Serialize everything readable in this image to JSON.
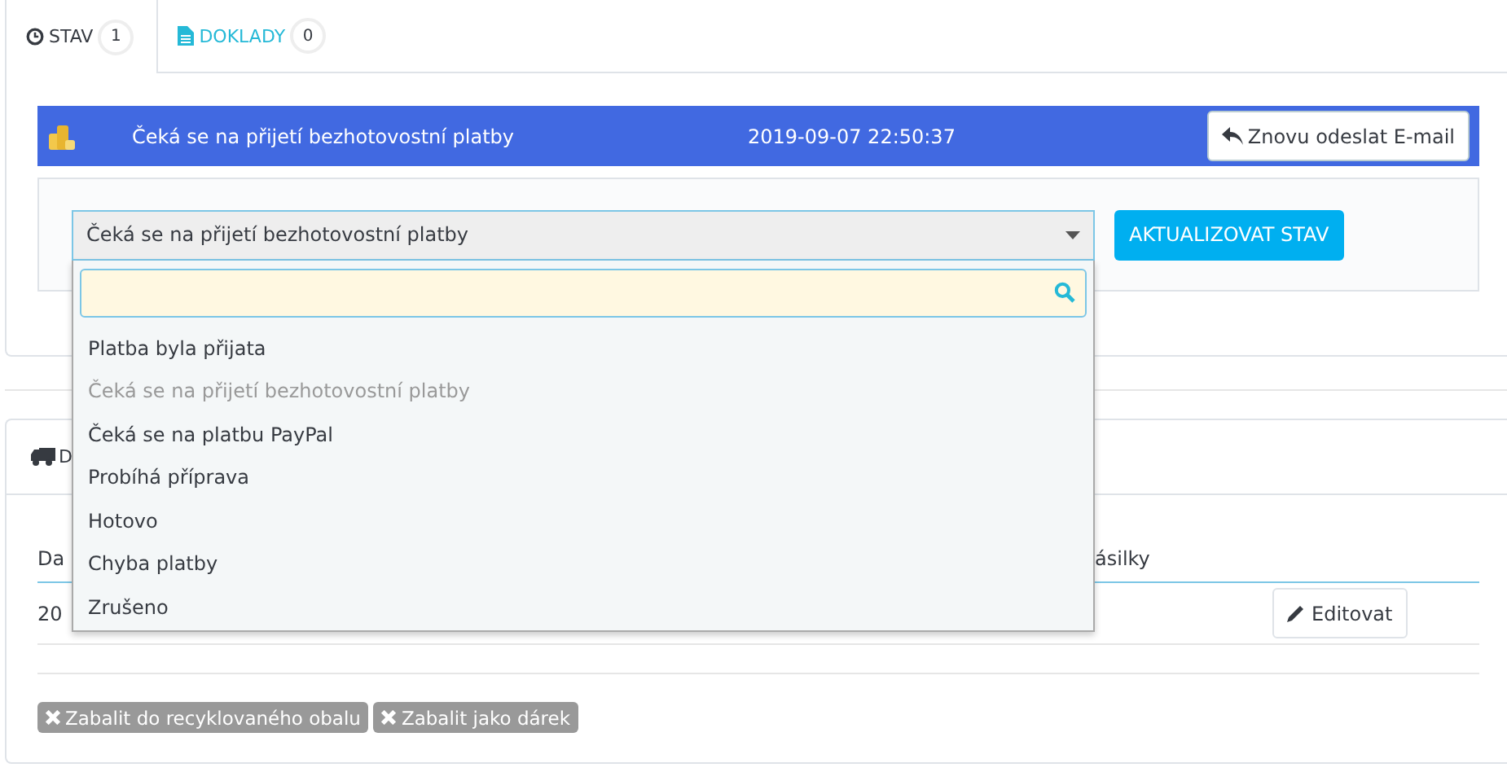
{
  "tabs": [
    {
      "label": "STAV",
      "count": "1",
      "selected": true
    },
    {
      "label": "DOKLADY",
      "count": "0",
      "selected": false
    }
  ],
  "status_bar": {
    "status": "Čeká se na přijetí bezhotovostní platby",
    "date": "2019-09-07 22:50:37",
    "resend_button": "Znovu odeslat E-mail"
  },
  "status_select": {
    "value": "Čeká se na přijetí bezhotovostní platby",
    "expanded": true,
    "options": [
      {
        "label": "Platba byla přijata",
        "disabled": false
      },
      {
        "label": "Čeká se na přijetí bezhotovostní platby",
        "disabled": true
      },
      {
        "label": "Čeká se na platbu PayPal",
        "disabled": false
      },
      {
        "label": "Probíhá příprava",
        "disabled": false
      },
      {
        "label": "Hotovo",
        "disabled": false
      },
      {
        "label": "Chyba platby",
        "disabled": false
      },
      {
        "label": "Zrušeno",
        "disabled": false
      }
    ]
  },
  "update_button": "AKTUALIZOVAT STAV",
  "shipping": {
    "title": "D",
    "columns": [
      "Da",
      "ásilky"
    ],
    "row": {
      "cell_1": "20",
      "edit_button": "Editovat"
    }
  },
  "tags": [
    "Zabalit do recyklovaného obalu",
    "Zabalit jako dárek"
  ]
}
